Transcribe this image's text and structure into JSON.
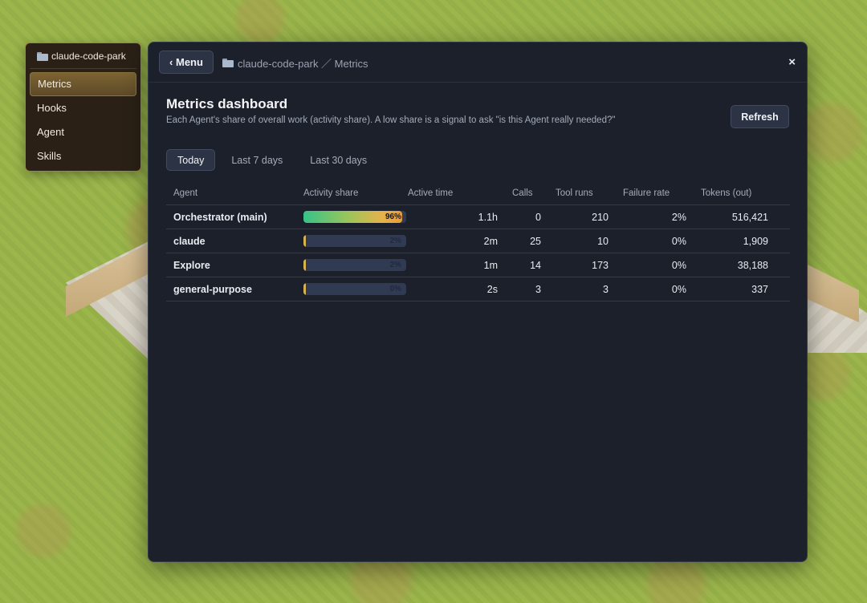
{
  "side_menu": {
    "project": "claude-code-park",
    "items": [
      {
        "label": "Metrics",
        "active": true
      },
      {
        "label": "Hooks",
        "active": false
      },
      {
        "label": "Agent",
        "active": false
      },
      {
        "label": "Skills",
        "active": false
      }
    ]
  },
  "header": {
    "menu_label": "‹ Menu",
    "breadcrumb": "claude-code-park ／ Metrics",
    "close_label": "×"
  },
  "dashboard": {
    "title": "Metrics dashboard",
    "subtitle": "Each Agent's share of overall work (activity share). A low share is a signal to ask \"is this Agent really needed?\"",
    "refresh_label": "Refresh",
    "tabs": [
      {
        "label": "Today",
        "active": true
      },
      {
        "label": "Last 7 days",
        "active": false
      },
      {
        "label": "Last 30 days",
        "active": false
      }
    ]
  },
  "table": {
    "columns": [
      "Agent",
      "Activity share",
      "Active time",
      "Calls",
      "Tool runs",
      "Failure rate",
      "Tokens (out)"
    ],
    "rows": [
      {
        "agent": "Orchestrator (main)",
        "share_label": "96%",
        "share": 96,
        "active_time": "1.1h",
        "calls": "0",
        "tool_runs": "210",
        "failure_rate": "2%",
        "tokens": "516,421"
      },
      {
        "agent": "claude",
        "share_label": "2%",
        "share": 2,
        "active_time": "2m",
        "calls": "25",
        "tool_runs": "10",
        "failure_rate": "0%",
        "tokens": "1,909"
      },
      {
        "agent": "Explore",
        "share_label": "2%",
        "share": 2,
        "active_time": "1m",
        "calls": "14",
        "tool_runs": "173",
        "failure_rate": "0%",
        "tokens": "38,188"
      },
      {
        "agent": "general-purpose",
        "share_label": "0%",
        "share": 0,
        "active_time": "2s",
        "calls": "3",
        "tool_runs": "3",
        "failure_rate": "0%",
        "tokens": "337"
      }
    ]
  },
  "icons": {
    "folder": "folder-icon",
    "close": "close-icon"
  }
}
